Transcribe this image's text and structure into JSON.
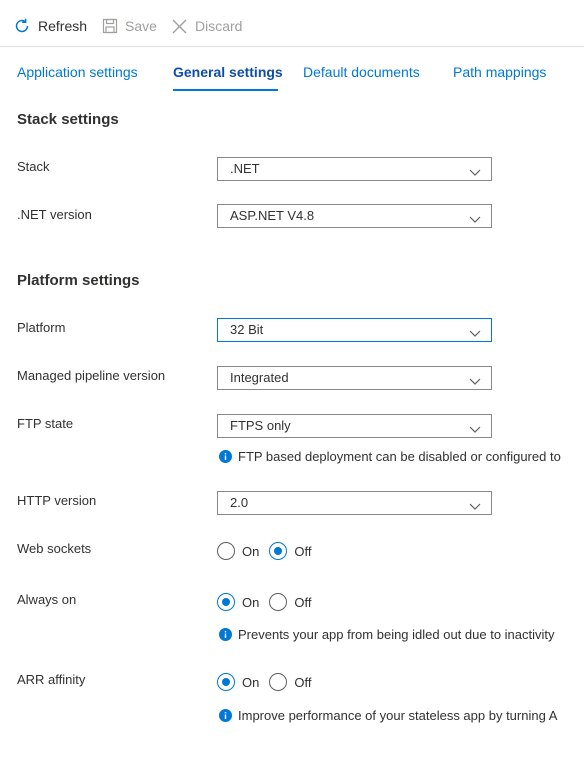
{
  "toolbar": {
    "refresh_label": "Refresh",
    "save_label": "Save",
    "discard_label": "Discard"
  },
  "tabs": [
    {
      "label": "Application settings",
      "active": false
    },
    {
      "label": "General settings",
      "active": true
    },
    {
      "label": "Default documents",
      "active": false
    },
    {
      "label": "Path mappings",
      "active": false
    }
  ],
  "stack_section": {
    "title": "Stack settings",
    "stack": {
      "label": "Stack",
      "value": ".NET"
    },
    "net_version": {
      "label": ".NET version",
      "value": "ASP.NET V4.8"
    }
  },
  "platform_section": {
    "title": "Platform settings",
    "platform": {
      "label": "Platform",
      "value": "32 Bit"
    },
    "pipeline": {
      "label": "Managed pipeline version",
      "value": "Integrated"
    },
    "ftp_state": {
      "label": "FTP state",
      "value": "FTPS only",
      "info": "FTP based deployment can be disabled or configured to"
    },
    "http_version": {
      "label": "HTTP version",
      "value": "2.0"
    },
    "web_sockets": {
      "label": "Web sockets",
      "on_label": "On",
      "off_label": "Off",
      "selected": "Off"
    },
    "always_on": {
      "label": "Always on",
      "on_label": "On",
      "off_label": "Off",
      "selected": "On",
      "info": "Prevents your app from being idled out due to inactivity"
    },
    "arr_affinity": {
      "label": "ARR affinity",
      "on_label": "On",
      "off_label": "Off",
      "selected": "On",
      "info": "Improve performance of your stateless app by turning A"
    }
  },
  "colors": {
    "accent": "#0078d4",
    "text": "#323130",
    "disabled": "#a19f9d",
    "border": "#8a8886"
  }
}
